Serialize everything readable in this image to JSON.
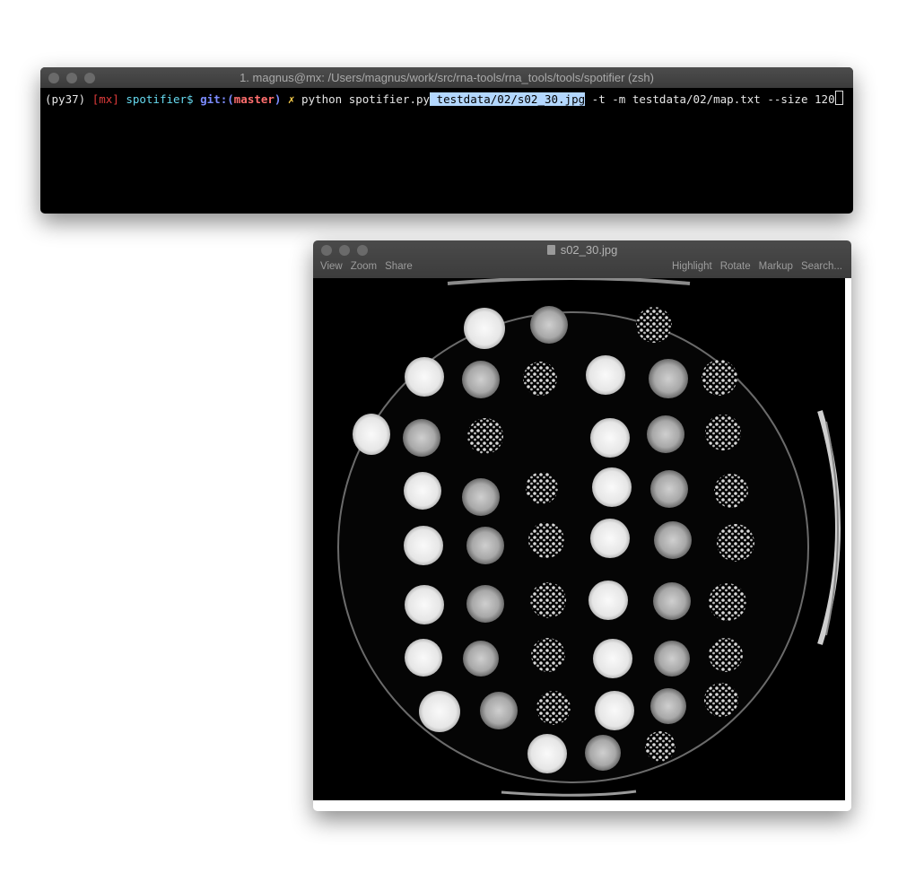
{
  "terminal": {
    "title": "1. magnus@mx: /Users/magnus/work/src/rna-tools/rna_tools/tools/spotifier (zsh)",
    "prompt_env": "(py37)",
    "prompt_host": "[mx]",
    "prompt_dir": "spotifier$",
    "git_label": "git:(",
    "git_branch": "master",
    "git_close": ")",
    "dirty_mark": "✗",
    "cmd_pre": "python spotifier.py",
    "cmd_selected": " testdata/02/s02_30.jpg",
    "cmd_post": " -t -m testdata/02/map.txt --size 120"
  },
  "preview": {
    "title": "s02_30.jpg",
    "toolbar_left": [
      "View",
      "Zoom",
      "Share"
    ],
    "toolbar_right": [
      "Highlight",
      "Rotate",
      "Markup",
      "Search..."
    ]
  },
  "colors": {
    "terminal_bg": "#000000",
    "selection": "#b3d7ff",
    "titlebar": "#3f3f3f"
  }
}
